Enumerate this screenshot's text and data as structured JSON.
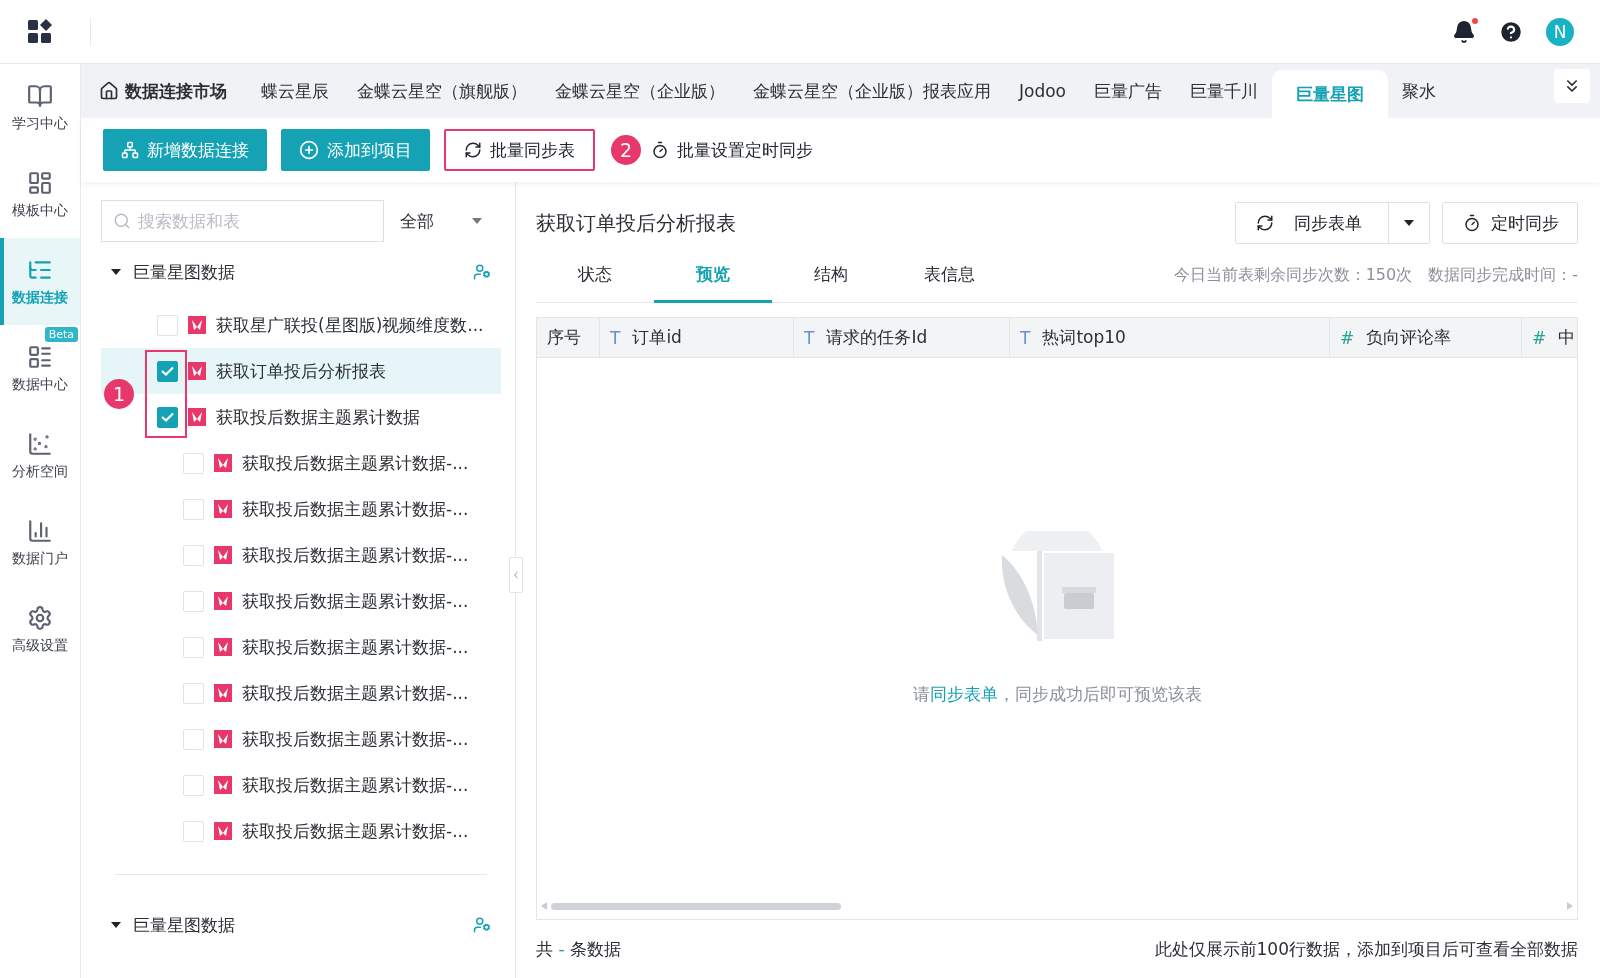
{
  "top_bar": {
    "notification_dot": true,
    "avatar": "N"
  },
  "nav": [
    {
      "label": "学习中心",
      "selected": false
    },
    {
      "label": "模板中心",
      "selected": false
    },
    {
      "label": "数据连接",
      "selected": true
    },
    {
      "label": "数据中心",
      "selected": false,
      "badge": "Beta"
    },
    {
      "label": "分析空间",
      "selected": false
    },
    {
      "label": "数据门户",
      "selected": false
    },
    {
      "label": "高级设置",
      "selected": false
    }
  ],
  "tab_bar": {
    "home": "数据连接市场",
    "tabs": [
      {
        "label": "蝶云星辰",
        "selected": false
      },
      {
        "label": "金蝶云星空（旗舰版）",
        "selected": false
      },
      {
        "label": "金蝶云星空（企业版）",
        "selected": false
      },
      {
        "label": "金蝶云星空（企业版）报表应用",
        "selected": false
      },
      {
        "label": "Jodoo",
        "selected": false
      },
      {
        "label": "巨量广告",
        "selected": false
      },
      {
        "label": "巨量千川",
        "selected": false
      },
      {
        "label": "巨量星图",
        "selected": true
      },
      {
        "label": "聚水",
        "selected": false
      }
    ]
  },
  "toolbar": {
    "buttons": [
      {
        "label": "新增数据连接",
        "kind": "primary",
        "highlighted": false
      },
      {
        "label": "添加到项目",
        "kind": "primary",
        "highlighted": false
      },
      {
        "label": "批量同步表",
        "kind": "outlined",
        "highlighted": true
      },
      {
        "label": "批量设置定时同步",
        "kind": "plain",
        "highlighted": false
      }
    ],
    "marker": "2"
  },
  "search": {
    "placeholder": "搜索数据和表",
    "filter": "全部"
  },
  "tree": {
    "marker": "1",
    "groups": [
      {
        "title": "巨量星图数据",
        "expanded": true,
        "items": [
          {
            "label": "获取星广联投(星图版)视频维度数...",
            "checked": false,
            "selected": false
          },
          {
            "label": "获取订单投后分析报表",
            "checked": true,
            "selected": true
          },
          {
            "label": "获取投后数据主题累计数据",
            "checked": true,
            "selected": false,
            "children": [
              {
                "label": "获取投后数据主题累计数据-...",
                "checked": false,
                "selected": false
              },
              {
                "label": "获取投后数据主题累计数据-...",
                "checked": false,
                "selected": false
              },
              {
                "label": "获取投后数据主题累计数据-...",
                "checked": false,
                "selected": false
              },
              {
                "label": "获取投后数据主题累计数据-...",
                "checked": false,
                "selected": false
              },
              {
                "label": "获取投后数据主题累计数据-...",
                "checked": false,
                "selected": false
              },
              {
                "label": "获取投后数据主题累计数据-...",
                "checked": false,
                "selected": false
              },
              {
                "label": "获取投后数据主题累计数据-...",
                "checked": false,
                "selected": false
              },
              {
                "label": "获取投后数据主题累计数据-...",
                "checked": false,
                "selected": false
              },
              {
                "label": "获取投后数据主题累计数据-...",
                "checked": false,
                "selected": false
              }
            ]
          }
        ]
      },
      {
        "title": "巨量星图数据",
        "expanded": true
      }
    ]
  },
  "detail": {
    "title": "获取订单投后分析报表",
    "sync_button": "同步表单",
    "schedule_button": "定时同步",
    "tabs": [
      {
        "label": "状态",
        "selected": false
      },
      {
        "label": "预览",
        "selected": true
      },
      {
        "label": "结构",
        "selected": false
      },
      {
        "label": "表信息",
        "selected": false
      }
    ],
    "remaining": "今日当前表剩余同步次数：150次",
    "finished": "数据同步完成时间：-",
    "columns": [
      {
        "label": "序号"
      },
      {
        "label": "订单id",
        "type_mark": "T",
        "kind": "text"
      },
      {
        "label": "请求的任务Id",
        "type_mark": "T",
        "kind": "text"
      },
      {
        "label": "热词top10",
        "type_mark": "T",
        "kind": "text"
      },
      {
        "label": "负向评论率",
        "type_mark": "#",
        "kind": "number"
      },
      {
        "label": "中",
        "type_mark": "#",
        "kind": "number"
      }
    ],
    "empty": {
      "prefix": "请",
      "link": "同步表单",
      "suffix": "，同步成功后即可预览该表"
    },
    "footer": {
      "prefix": "共",
      "count": "-",
      "suffix": "条数据",
      "note": "此处仅展示前100行数据，添加到项目后可查看全部数据"
    }
  }
}
